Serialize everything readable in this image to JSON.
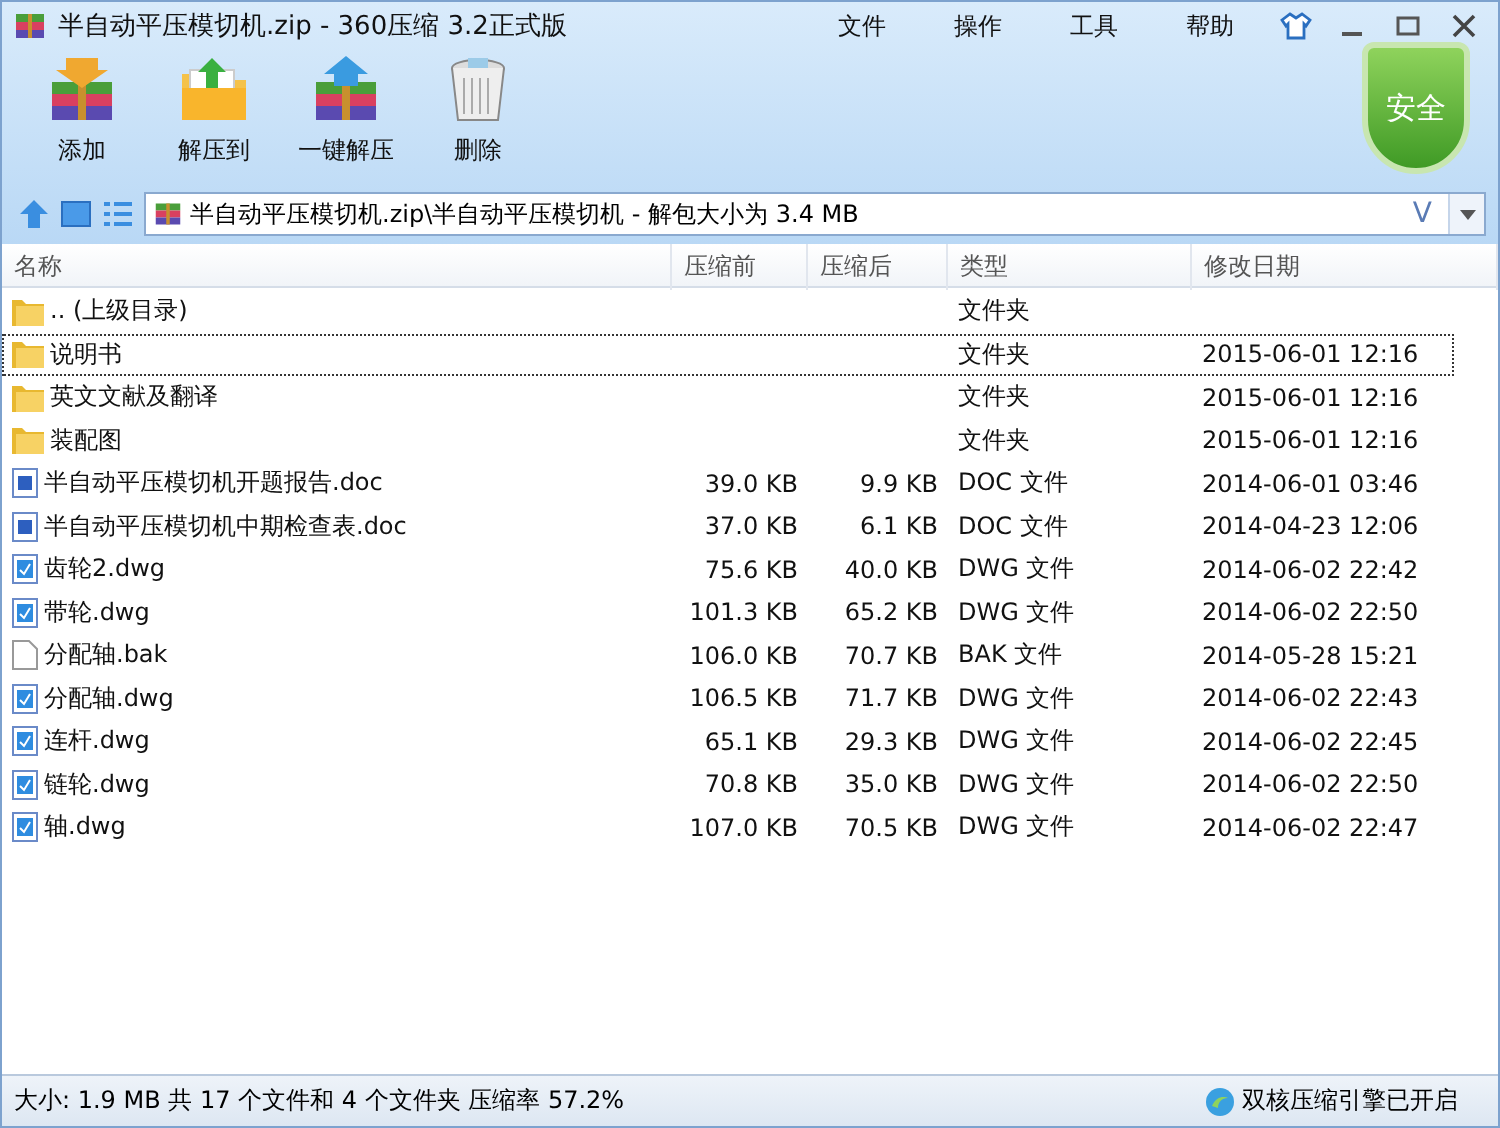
{
  "window": {
    "title": "半自动平压模切机.zip - 360压缩 3.2正式版"
  },
  "menu": [
    "文件",
    "操作",
    "工具",
    "帮助"
  ],
  "toolbar": [
    {
      "label": "添加",
      "kind": "add"
    },
    {
      "label": "解压到",
      "kind": "extract"
    },
    {
      "label": "一键解压",
      "kind": "oneclick"
    },
    {
      "label": "删除",
      "kind": "delete"
    }
  ],
  "security_badge": "安全",
  "address": {
    "value": "半自动平压模切机.zip\\半自动平压模切机 - 解包大小为 3.4 MB",
    "dropdown": "V"
  },
  "table": {
    "columns": [
      "名称",
      "压缩前",
      "压缩后",
      "类型",
      "修改日期"
    ],
    "rows": [
      {
        "kind": "folder",
        "name": ".. (上级目录)",
        "size": "",
        "packed": "",
        "type": "文件夹",
        "date": "",
        "selected": false
      },
      {
        "kind": "folder",
        "name": "说明书",
        "size": "",
        "packed": "",
        "type": "文件夹",
        "date": "2015-06-01 12:16",
        "selected": true
      },
      {
        "kind": "folder",
        "name": "英文文献及翻译",
        "size": "",
        "packed": "",
        "type": "文件夹",
        "date": "2015-06-01 12:16",
        "selected": false
      },
      {
        "kind": "folder",
        "name": "装配图",
        "size": "",
        "packed": "",
        "type": "文件夹",
        "date": "2015-06-01 12:16",
        "selected": false
      },
      {
        "kind": "doc",
        "name": "半自动平压模切机开题报告.doc",
        "size": "39.0 KB",
        "packed": "9.9 KB",
        "type": "DOC 文件",
        "date": "2014-06-01 03:46",
        "selected": false
      },
      {
        "kind": "doc",
        "name": "半自动平压模切机中期检查表.doc",
        "size": "37.0 KB",
        "packed": "6.1 KB",
        "type": "DOC 文件",
        "date": "2014-04-23 12:06",
        "selected": false
      },
      {
        "kind": "dwg",
        "name": "齿轮2.dwg",
        "size": "75.6 KB",
        "packed": "40.0 KB",
        "type": "DWG 文件",
        "date": "2014-06-02 22:42",
        "selected": false
      },
      {
        "kind": "dwg",
        "name": "带轮.dwg",
        "size": "101.3 KB",
        "packed": "65.2 KB",
        "type": "DWG 文件",
        "date": "2014-06-02 22:50",
        "selected": false
      },
      {
        "kind": "file",
        "name": "分配轴.bak",
        "size": "106.0 KB",
        "packed": "70.7 KB",
        "type": "BAK 文件",
        "date": "2014-05-28 15:21",
        "selected": false
      },
      {
        "kind": "dwg",
        "name": "分配轴.dwg",
        "size": "106.5 KB",
        "packed": "71.7 KB",
        "type": "DWG 文件",
        "date": "2014-06-02 22:43",
        "selected": false
      },
      {
        "kind": "dwg",
        "name": "连杆.dwg",
        "size": "65.1 KB",
        "packed": "29.3 KB",
        "type": "DWG 文件",
        "date": "2014-06-02 22:45",
        "selected": false
      },
      {
        "kind": "dwg",
        "name": "链轮.dwg",
        "size": "70.8 KB",
        "packed": "35.0 KB",
        "type": "DWG 文件",
        "date": "2014-06-02 22:50",
        "selected": false
      },
      {
        "kind": "dwg",
        "name": "轴.dwg",
        "size": "107.0 KB",
        "packed": "70.5 KB",
        "type": "DWG 文件",
        "date": "2014-06-02 22:47",
        "selected": false
      }
    ]
  },
  "status_bar": {
    "summary": "大小: 1.9 MB 共 17 个文件和 4 个文件夹 压缩率 57.2%",
    "engine": "双核压缩引擎已开启"
  }
}
